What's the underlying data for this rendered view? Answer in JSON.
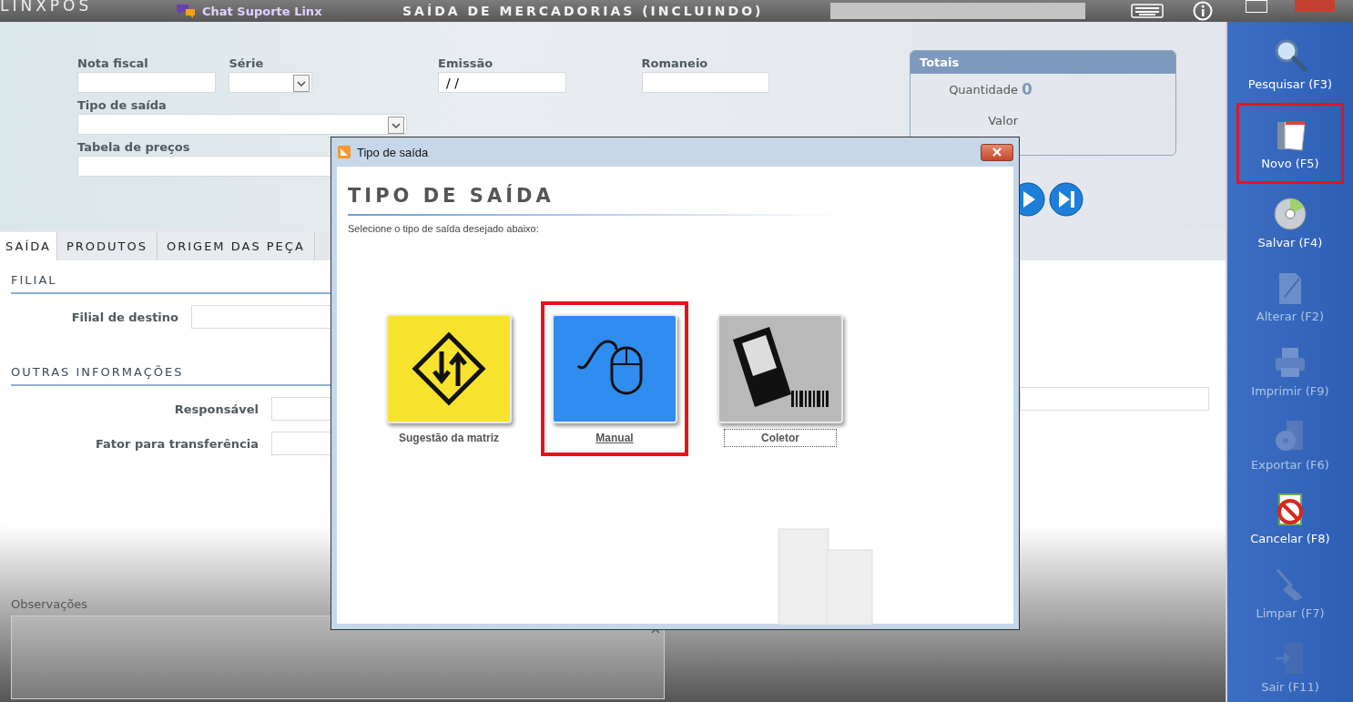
{
  "top_bar": {
    "logo": "LINXPOS",
    "chat_link": "Chat Suporte Linx",
    "title": "SAÍDA DE MERCADORIAS (INCLUINDO)"
  },
  "header_form": {
    "nota_fiscal": {
      "label": "Nota fiscal"
    },
    "serie": {
      "label": "Série"
    },
    "emissao": {
      "label": "Emissão",
      "value": " / /"
    },
    "romaneio": {
      "label": "Romaneio"
    },
    "tipo_de_saida": {
      "label": "Tipo de saída"
    },
    "tabela_de_precos": {
      "label": "Tabela de preços"
    }
  },
  "totais": {
    "title": "Totais",
    "rows": [
      {
        "label": "Quantidade",
        "value": "0"
      },
      {
        "label": "Valor"
      }
    ]
  },
  "tabs": [
    {
      "label": "SAÍDA",
      "selected": true
    },
    {
      "label": "PRODUTOS",
      "selected": false
    },
    {
      "label": "ORIGEM DAS PEÇA",
      "selected": false
    }
  ],
  "sections": [
    {
      "title": "FILIAL",
      "fields": [
        {
          "label": "Filial de destino"
        }
      ]
    },
    {
      "title": "OUTRAS INFORMAÇÕES",
      "fields": [
        {
          "label": "Responsável"
        },
        {
          "label": "Fator para transferência"
        }
      ]
    }
  ],
  "observacoes": {
    "label": "Observações"
  },
  "sidebar": {
    "items": [
      {
        "label": "Pesquisar (F3)",
        "kind": "search",
        "disabled": false,
        "highlighted": false
      },
      {
        "label": "Novo (F5)",
        "kind": "new",
        "disabled": false,
        "highlighted": true
      },
      {
        "label": "Salvar (F4)",
        "kind": "save",
        "disabled": false,
        "highlighted": false
      },
      {
        "label": "Alterar (F2)",
        "kind": "edit",
        "disabled": true,
        "highlighted": false
      },
      {
        "label": "Imprimir (F9)",
        "kind": "print",
        "disabled": true,
        "highlighted": false
      },
      {
        "label": "Exportar (F6)",
        "kind": "export",
        "disabled": true,
        "highlighted": false
      },
      {
        "label": "Cancelar (F8)",
        "kind": "cancel",
        "disabled": false,
        "highlighted": false
      },
      {
        "label": "Limpar (F7)",
        "kind": "clear",
        "disabled": true,
        "highlighted": false
      },
      {
        "label": "Sair (F11)",
        "kind": "exit",
        "disabled": true,
        "highlighted": false
      }
    ]
  },
  "dialog": {
    "title": "Tipo de saída",
    "heading": "TIPO DE SAÍDA",
    "instruction": "Selecione o tipo de saída desejado abaixo:",
    "options": [
      {
        "label": "Sugestão da matriz",
        "kind": "sign",
        "color": "#f7e22e",
        "highlighted": false,
        "focused": false,
        "selected": false
      },
      {
        "label": "Manual",
        "kind": "mouse",
        "color": "#2f8df0",
        "highlighted": true,
        "focused": false,
        "selected": true
      },
      {
        "label": "Coletor",
        "kind": "collector",
        "color": "#b9b9b9",
        "highlighted": false,
        "focused": true,
        "selected": false
      }
    ]
  }
}
